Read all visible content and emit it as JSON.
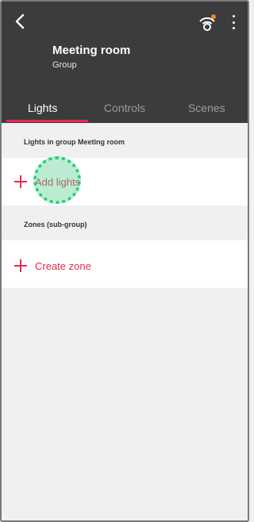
{
  "header": {
    "title": "Meeting room",
    "subtitle": "Group",
    "back_icon": "chevron-left-icon",
    "hub_icon": "wifi-bridge-icon",
    "more_icon": "more-vertical-icon"
  },
  "tabs": [
    {
      "label": "Lights",
      "active": true
    },
    {
      "label": "Controls",
      "active": false
    },
    {
      "label": "Scenes",
      "active": false
    }
  ],
  "sections": {
    "lights_header": "Lights in group Meeting room",
    "add_lights_label": "Add lights",
    "zones_header": "Zones (sub-group)",
    "create_zone_label": "Create zone"
  },
  "colors": {
    "header_bg": "#3c3c3e",
    "accent": "#e8294f",
    "tap_marker": "#1fcf72"
  }
}
